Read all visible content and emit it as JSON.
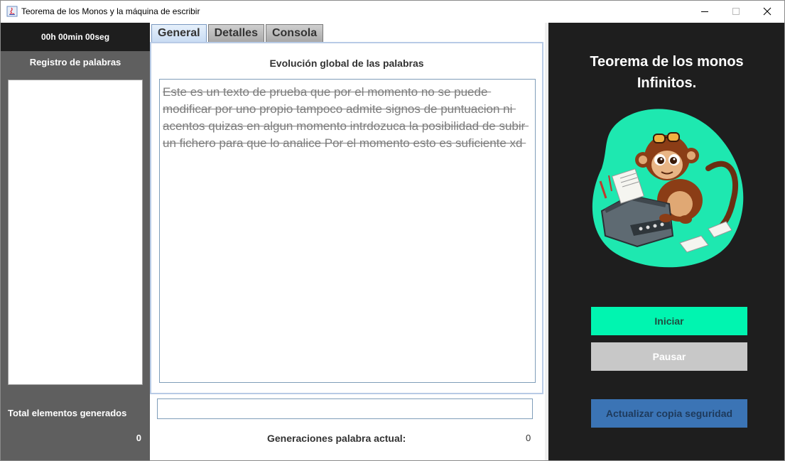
{
  "window": {
    "title": "Teorema de los Monos y la máquina de escribir",
    "controls": {
      "minimize": "minimize-icon",
      "maximize": "maximize-icon",
      "close": "close-icon"
    }
  },
  "left": {
    "timer": "00h 00min 00seg",
    "registro_label": "Registro de palabras",
    "total_label": "Total elementos generados",
    "total_value": "0"
  },
  "center": {
    "tabs": [
      {
        "label": "General",
        "active": true
      },
      {
        "label": "Detalles",
        "active": false
      },
      {
        "label": "Consola",
        "active": false
      }
    ],
    "evolucion_title": "Evolución global de las palabras",
    "evolucion_text": "Este es un texto de prueba que por el momento no se puede modificar por uno propio tampoco admite signos de puntuacion ni acentos quizas en algun momento intrdozuca la posibilidad de subir un fichero para que lo analice Por el momento esto es suficiente xd ",
    "palabra_input_value": "",
    "generaciones_label": "Generaciones palabra actual:",
    "generaciones_value": "0"
  },
  "right": {
    "title_line1": "Teorema de los monos",
    "title_line2": "Infinitos.",
    "image": "monkey-typewriter-illustration",
    "buttons": {
      "iniciar": "Iniciar",
      "pausar": "Pausar",
      "actualizar": "Actualizar copia seguridad"
    }
  },
  "colors": {
    "accent_green": "#00f5b0",
    "dark_bg": "#1e1e1e",
    "left_gray": "#5f5f5f",
    "pause_disabled": "#c8c8c8",
    "backup_blue": "#3b74b5"
  }
}
